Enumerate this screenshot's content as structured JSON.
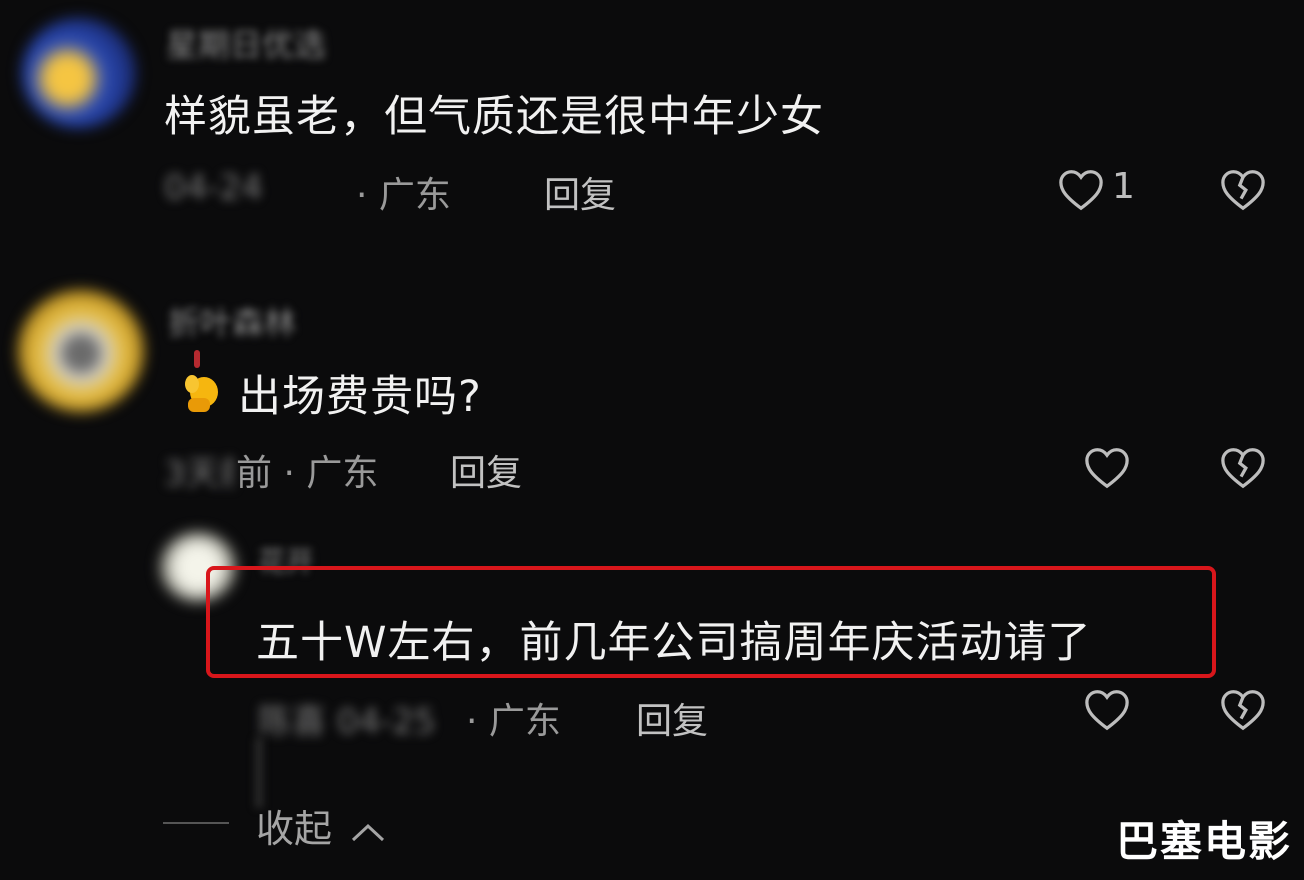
{
  "comments": [
    {
      "username": "星期日优选",
      "text": "样貌虽老，但气质还是很中年少女",
      "date": "04-24",
      "location": "· 广东",
      "reply_label": "回复",
      "likes": "1"
    },
    {
      "username": "折叶森林",
      "text": "出场费贵吗?",
      "date": "3天前",
      "location": "前 · 广东",
      "reply_label": "回复"
    },
    {
      "username": "花开",
      "text": "五十W左右，前几年公司搞周年庆活动请了",
      "date": "陈喜 04-25",
      "location": "· 广东",
      "reply_label": "回复"
    }
  ],
  "collapse_label": "收起",
  "watermark": "巴塞电影",
  "colors": {
    "background": "#0b0b0c",
    "highlight_border": "#d8161b",
    "text": "#f1f1f1",
    "meta": "#9a9a9a"
  },
  "icons": [
    "heart-outline-icon",
    "broken-heart-icon",
    "chevron-up-icon",
    "pinching-hand-emoji"
  ]
}
